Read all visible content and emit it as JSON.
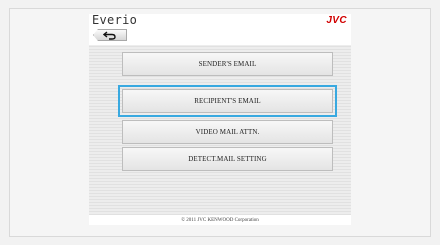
{
  "header": {
    "app_title": "Everio",
    "brand_logo": "JVC"
  },
  "toolbar": {
    "back_icon": "return-arrow-icon"
  },
  "menu": {
    "items": [
      {
        "label": "SENDER'S EMAIL",
        "selected": false
      },
      {
        "label": "RECIPIENT'S EMAIL",
        "selected": true
      },
      {
        "label": "VIDEO MAIL ATTN.",
        "selected": false
      },
      {
        "label": "DETECT.MAIL SETTING",
        "selected": false
      }
    ]
  },
  "footer": {
    "copyright": "© 2011 JVC KENWOOD Corporation"
  },
  "colors": {
    "brand_red": "#d10000",
    "selection_blue": "#39a9e0"
  }
}
